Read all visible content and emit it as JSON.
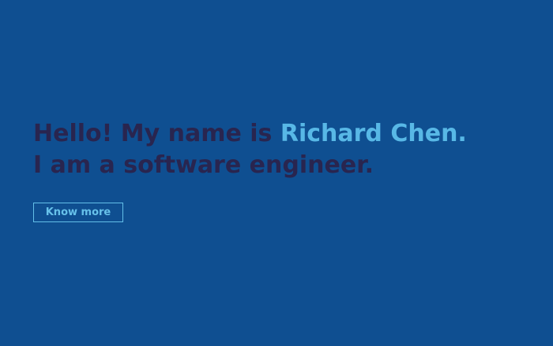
{
  "hero": {
    "greeting_prefix": "Hello! My name is ",
    "name": "Richard Chen.",
    "tagline": "I am a software engineer.",
    "cta_label": "Know more"
  },
  "colors": {
    "background": "#0f4f91",
    "headline": "#29254f",
    "accent": "#58b8e6"
  }
}
